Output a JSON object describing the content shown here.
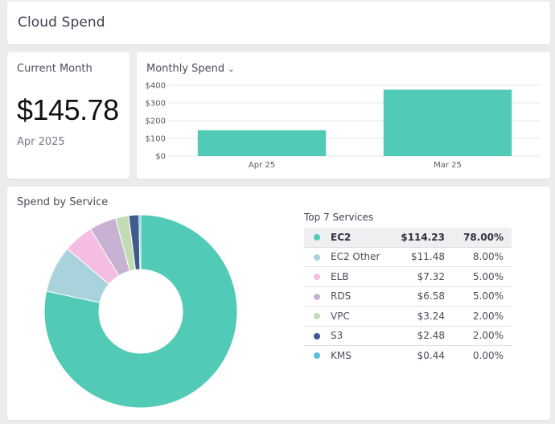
{
  "header": {
    "title": "Cloud Spend"
  },
  "current_month": {
    "label": "Current Month",
    "amount": "$145.78",
    "period": "Apr 2025"
  },
  "monthly_spend": {
    "title": "Monthly Spend",
    "dropdown_icon": "chevron-down-icon",
    "bar_color": "#52cbb6"
  },
  "service_breakdown": {
    "title": "Spend by Service",
    "top_title": "Top 7 Services",
    "rows": [
      {
        "name": "EC2",
        "amount": "$114.23",
        "percent": "78.00%",
        "color": "#52cbb6"
      },
      {
        "name": "EC2 Other",
        "amount": "$11.48",
        "percent": "8.00%",
        "color": "#a9d3dc"
      },
      {
        "name": "ELB",
        "amount": "$7.32",
        "percent": "5.00%",
        "color": "#f5bde1"
      },
      {
        "name": "RDS",
        "amount": "$6.58",
        "percent": "5.00%",
        "color": "#c7b2d4"
      },
      {
        "name": "VPC",
        "amount": "$3.24",
        "percent": "2.00%",
        "color": "#c2dcb6"
      },
      {
        "name": "S3",
        "amount": "$2.48",
        "percent": "2.00%",
        "color": "#3e5b8c"
      },
      {
        "name": "KMS",
        "amount": "$0.44",
        "percent": "0.00%",
        "color": "#5bbfe0"
      }
    ]
  },
  "chart_data": [
    {
      "type": "bar",
      "title": "Monthly Spend",
      "categories": [
        "Apr 25",
        "Mar 25"
      ],
      "values": [
        145.78,
        375
      ],
      "yticks": [
        "$0",
        "$100",
        "$200",
        "$300",
        "$400"
      ],
      "ylim": [
        0,
        400
      ],
      "grid": true,
      "color": "#52cbb6"
    },
    {
      "type": "pie",
      "title": "Spend by Service",
      "categories": [
        "EC2",
        "EC2 Other",
        "ELB",
        "RDS",
        "VPC",
        "S3",
        "KMS"
      ],
      "values": [
        114.23,
        11.48,
        7.32,
        6.58,
        3.24,
        2.48,
        0.44
      ],
      "colors": [
        "#52cbb6",
        "#a9d3dc",
        "#f5bde1",
        "#c7b2d4",
        "#c2dcb6",
        "#3e5b8c",
        "#5bbfe0"
      ]
    }
  ]
}
